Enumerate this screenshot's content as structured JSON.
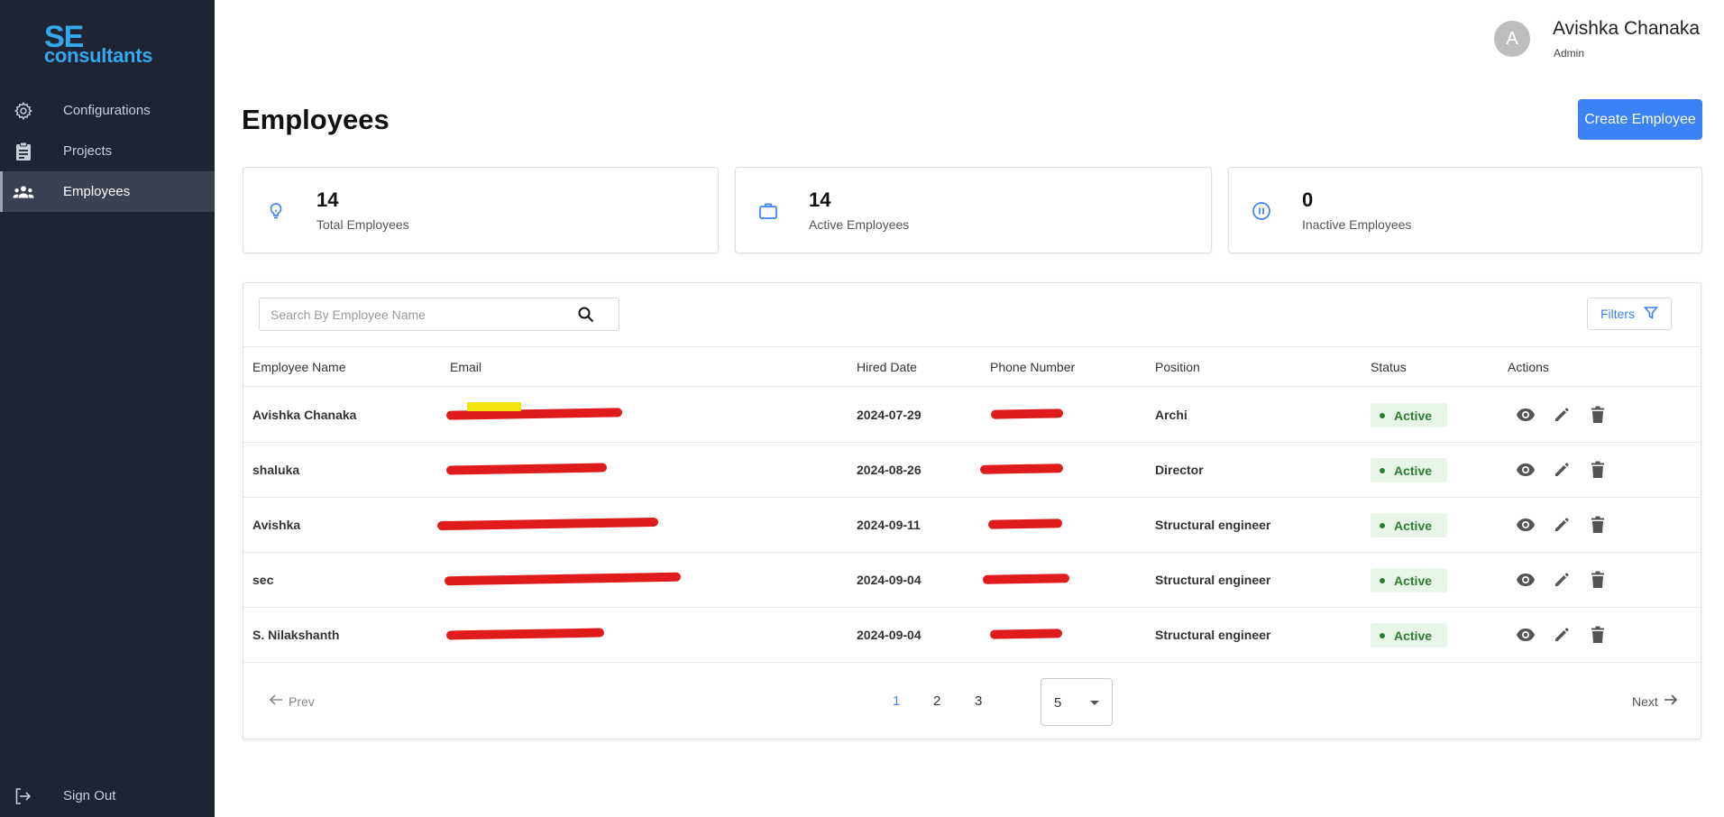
{
  "sidebar": {
    "logo_top": "SE",
    "logo_bottom": "consultants",
    "items": [
      {
        "label": "Configurations",
        "icon": "gear-icon"
      },
      {
        "label": "Projects",
        "icon": "clipboard-icon"
      },
      {
        "label": "Employees",
        "icon": "people-icon",
        "active": true
      }
    ],
    "sign_out": "Sign Out"
  },
  "header": {
    "avatar_letter": "A",
    "user_name": "Avishka Chanaka",
    "user_role": "Admin"
  },
  "page": {
    "title": "Employees",
    "create_button": "Create Employee"
  },
  "stats": [
    {
      "value": "14",
      "label": "Total Employees",
      "icon": "lightbulb-icon"
    },
    {
      "value": "14",
      "label": "Active Employees",
      "icon": "briefcase-icon"
    },
    {
      "value": "0",
      "label": "Inactive Employees",
      "icon": "pause-icon"
    }
  ],
  "table": {
    "search_placeholder": "Search By Employee Name",
    "filters_label": "Filters",
    "columns": [
      "Employee Name",
      "Email",
      "Hired Date",
      "Phone Number",
      "Position",
      "Status",
      "Actions"
    ],
    "rows": [
      {
        "name": "Avishka Chanaka",
        "hired": "2024-07-29",
        "position": "Archi",
        "status": "Active"
      },
      {
        "name": "shaluka",
        "hired": "2024-08-26",
        "position": "Director",
        "status": "Active"
      },
      {
        "name": "Avishka",
        "hired": "2024-09-11",
        "position": "Structural engineer",
        "status": "Active"
      },
      {
        "name": "sec",
        "hired": "2024-09-04",
        "position": "Structural engineer",
        "status": "Active"
      },
      {
        "name": "S. Nilakshanth",
        "hired": "2024-09-04",
        "position": "Structural engineer",
        "status": "Active"
      }
    ]
  },
  "pagination": {
    "prev_label": "Prev",
    "next_label": "Next",
    "pages": [
      "1",
      "2",
      "3"
    ],
    "current_page": "1",
    "page_size": "5"
  },
  "colors": {
    "sidebar_bg": "#1e2433",
    "accent": "#3b82f6",
    "logo": "#35a8ea",
    "active_status": "#2e7d32",
    "redaction": "#e01b1b"
  }
}
